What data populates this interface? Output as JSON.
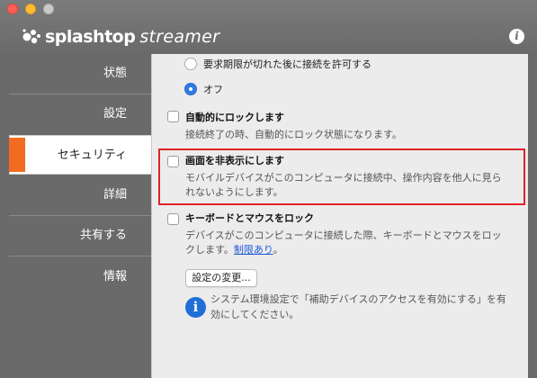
{
  "window": {
    "brand": "splashtop",
    "product": "streamer",
    "info_glyph": "i"
  },
  "sidebar": {
    "items": [
      {
        "label": "状態"
      },
      {
        "label": "設定"
      },
      {
        "label": "セキュリティ",
        "active": true
      },
      {
        "label": "詳細"
      },
      {
        "label": "共有する"
      },
      {
        "label": "情報"
      }
    ]
  },
  "security": {
    "radio_request_expired": "要求期限が切れた後に接続を許可する",
    "radio_off": "オフ",
    "auto_lock": {
      "title": "自動的にロックします",
      "desc": "接続終了の時、自動的にロック状態になります。"
    },
    "hide_screen": {
      "title": "画面を非表示にします",
      "desc_line1": "モバイルデバイスがこのコンピュータに接続中、操作内容を他人に見ら",
      "desc_line2": "れないようにします。"
    },
    "lock_kbm": {
      "title": "キーボードとマウスをロック",
      "desc_line1": "デバイスがこのコンピュータに接続した際、キーボードとマウスをロッ",
      "desc_line2_prefix": "クします。",
      "desc_link": "制限あり",
      "desc_line2_suffix": "。"
    },
    "change_settings_button": "設定の変更...",
    "note_line1": "システム環境設定で「補助デバイスのアクセスを有効にする」を有",
    "note_line2": "効にしてください。",
    "note_icon_glyph": "i"
  },
  "colors": {
    "accent": "#f26b21",
    "highlight": "#e0222a",
    "link": "#1e5bd6",
    "radio_selected": "#2f7ae5"
  }
}
